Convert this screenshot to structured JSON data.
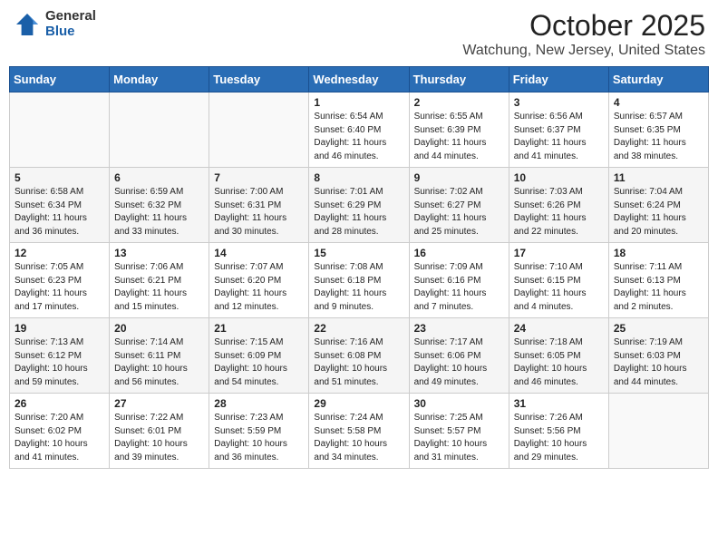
{
  "header": {
    "logo_general": "General",
    "logo_blue": "Blue",
    "month_title": "October 2025",
    "location": "Watchung, New Jersey, United States"
  },
  "weekdays": [
    "Sunday",
    "Monday",
    "Tuesday",
    "Wednesday",
    "Thursday",
    "Friday",
    "Saturday"
  ],
  "weeks": [
    [
      {
        "day": "",
        "info": ""
      },
      {
        "day": "",
        "info": ""
      },
      {
        "day": "",
        "info": ""
      },
      {
        "day": "1",
        "info": "Sunrise: 6:54 AM\nSunset: 6:40 PM\nDaylight: 11 hours\nand 46 minutes."
      },
      {
        "day": "2",
        "info": "Sunrise: 6:55 AM\nSunset: 6:39 PM\nDaylight: 11 hours\nand 44 minutes."
      },
      {
        "day": "3",
        "info": "Sunrise: 6:56 AM\nSunset: 6:37 PM\nDaylight: 11 hours\nand 41 minutes."
      },
      {
        "day": "4",
        "info": "Sunrise: 6:57 AM\nSunset: 6:35 PM\nDaylight: 11 hours\nand 38 minutes."
      }
    ],
    [
      {
        "day": "5",
        "info": "Sunrise: 6:58 AM\nSunset: 6:34 PM\nDaylight: 11 hours\nand 36 minutes."
      },
      {
        "day": "6",
        "info": "Sunrise: 6:59 AM\nSunset: 6:32 PM\nDaylight: 11 hours\nand 33 minutes."
      },
      {
        "day": "7",
        "info": "Sunrise: 7:00 AM\nSunset: 6:31 PM\nDaylight: 11 hours\nand 30 minutes."
      },
      {
        "day": "8",
        "info": "Sunrise: 7:01 AM\nSunset: 6:29 PM\nDaylight: 11 hours\nand 28 minutes."
      },
      {
        "day": "9",
        "info": "Sunrise: 7:02 AM\nSunset: 6:27 PM\nDaylight: 11 hours\nand 25 minutes."
      },
      {
        "day": "10",
        "info": "Sunrise: 7:03 AM\nSunset: 6:26 PM\nDaylight: 11 hours\nand 22 minutes."
      },
      {
        "day": "11",
        "info": "Sunrise: 7:04 AM\nSunset: 6:24 PM\nDaylight: 11 hours\nand 20 minutes."
      }
    ],
    [
      {
        "day": "12",
        "info": "Sunrise: 7:05 AM\nSunset: 6:23 PM\nDaylight: 11 hours\nand 17 minutes."
      },
      {
        "day": "13",
        "info": "Sunrise: 7:06 AM\nSunset: 6:21 PM\nDaylight: 11 hours\nand 15 minutes."
      },
      {
        "day": "14",
        "info": "Sunrise: 7:07 AM\nSunset: 6:20 PM\nDaylight: 11 hours\nand 12 minutes."
      },
      {
        "day": "15",
        "info": "Sunrise: 7:08 AM\nSunset: 6:18 PM\nDaylight: 11 hours\nand 9 minutes."
      },
      {
        "day": "16",
        "info": "Sunrise: 7:09 AM\nSunset: 6:16 PM\nDaylight: 11 hours\nand 7 minutes."
      },
      {
        "day": "17",
        "info": "Sunrise: 7:10 AM\nSunset: 6:15 PM\nDaylight: 11 hours\nand 4 minutes."
      },
      {
        "day": "18",
        "info": "Sunrise: 7:11 AM\nSunset: 6:13 PM\nDaylight: 11 hours\nand 2 minutes."
      }
    ],
    [
      {
        "day": "19",
        "info": "Sunrise: 7:13 AM\nSunset: 6:12 PM\nDaylight: 10 hours\nand 59 minutes."
      },
      {
        "day": "20",
        "info": "Sunrise: 7:14 AM\nSunset: 6:11 PM\nDaylight: 10 hours\nand 56 minutes."
      },
      {
        "day": "21",
        "info": "Sunrise: 7:15 AM\nSunset: 6:09 PM\nDaylight: 10 hours\nand 54 minutes."
      },
      {
        "day": "22",
        "info": "Sunrise: 7:16 AM\nSunset: 6:08 PM\nDaylight: 10 hours\nand 51 minutes."
      },
      {
        "day": "23",
        "info": "Sunrise: 7:17 AM\nSunset: 6:06 PM\nDaylight: 10 hours\nand 49 minutes."
      },
      {
        "day": "24",
        "info": "Sunrise: 7:18 AM\nSunset: 6:05 PM\nDaylight: 10 hours\nand 46 minutes."
      },
      {
        "day": "25",
        "info": "Sunrise: 7:19 AM\nSunset: 6:03 PM\nDaylight: 10 hours\nand 44 minutes."
      }
    ],
    [
      {
        "day": "26",
        "info": "Sunrise: 7:20 AM\nSunset: 6:02 PM\nDaylight: 10 hours\nand 41 minutes."
      },
      {
        "day": "27",
        "info": "Sunrise: 7:22 AM\nSunset: 6:01 PM\nDaylight: 10 hours\nand 39 minutes."
      },
      {
        "day": "28",
        "info": "Sunrise: 7:23 AM\nSunset: 5:59 PM\nDaylight: 10 hours\nand 36 minutes."
      },
      {
        "day": "29",
        "info": "Sunrise: 7:24 AM\nSunset: 5:58 PM\nDaylight: 10 hours\nand 34 minutes."
      },
      {
        "day": "30",
        "info": "Sunrise: 7:25 AM\nSunset: 5:57 PM\nDaylight: 10 hours\nand 31 minutes."
      },
      {
        "day": "31",
        "info": "Sunrise: 7:26 AM\nSunset: 5:56 PM\nDaylight: 10 hours\nand 29 minutes."
      },
      {
        "day": "",
        "info": ""
      }
    ]
  ]
}
